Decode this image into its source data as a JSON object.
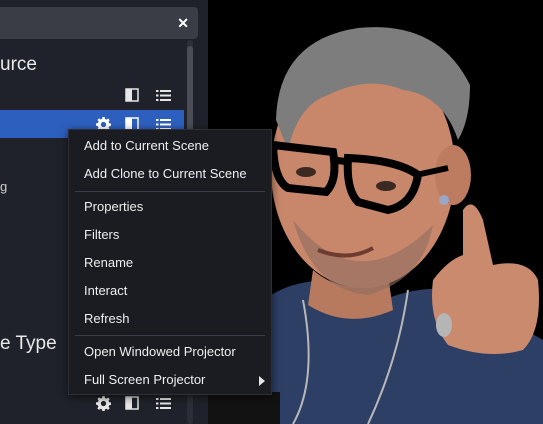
{
  "left_panel": {
    "section_1_title_fragment": "urce",
    "section_2_title_fragment": "e Type",
    "stub_text_fragment": "g"
  },
  "context_menu": {
    "items_group_1": [
      "Add to Current Scene",
      "Add Clone to Current Scene"
    ],
    "items_group_2": [
      "Properties",
      "Filters",
      "Rename",
      "Interact",
      "Refresh"
    ],
    "items_group_3": [
      "Open Windowed Projector",
      "Full Screen Projector"
    ]
  },
  "icons": {
    "close": "close-icon",
    "gear": "gear-icon",
    "layout": "layout-icon",
    "list": "list-icon",
    "submenu_arrow": "chevron-right-icon"
  },
  "colors": {
    "panel_bg": "#1f222a",
    "selection": "#2d5fbf",
    "menu_bg": "#1a1c22"
  }
}
